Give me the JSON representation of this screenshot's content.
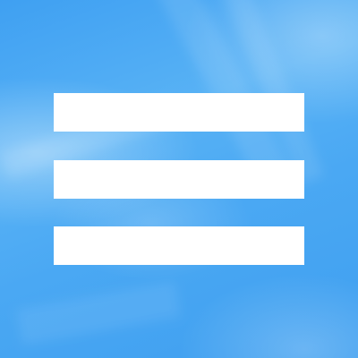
{
  "icon": {
    "name": "hamburger-menu-icon",
    "bar_count": 3,
    "bar_color": "#ffffff",
    "background_color": "#4aa8f3"
  }
}
